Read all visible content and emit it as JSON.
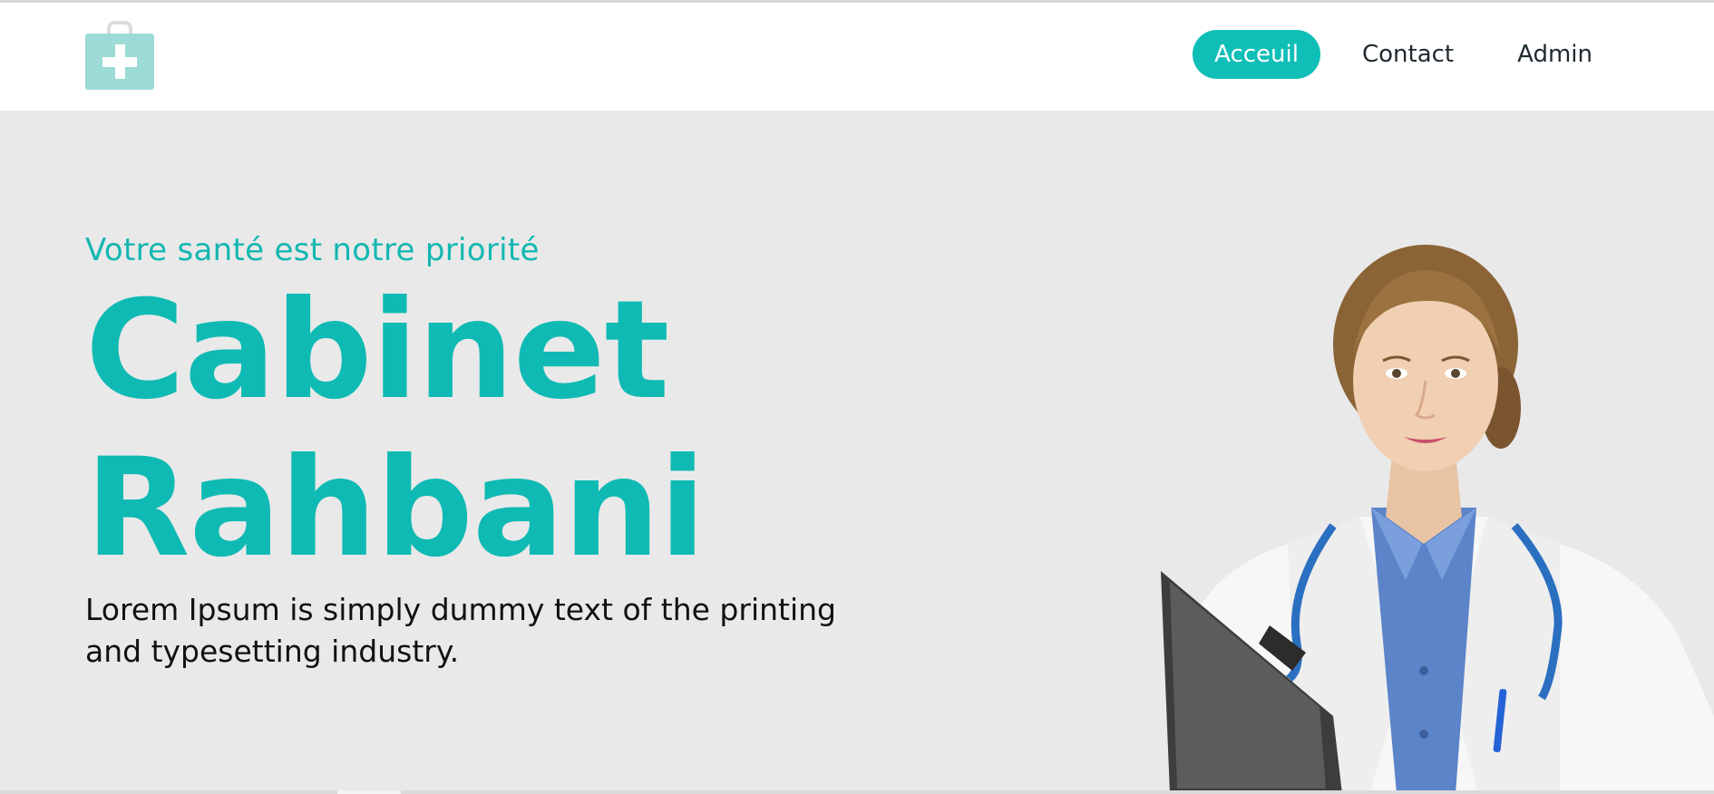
{
  "brand": {
    "logo_icon": "medical-kit-icon",
    "accent_color": "#0fbfb7"
  },
  "nav": {
    "items": [
      {
        "label": "Acceuil",
        "active": true
      },
      {
        "label": "Contact",
        "active": false
      },
      {
        "label": "Admin",
        "active": false
      }
    ]
  },
  "hero": {
    "tagline": "Votre santé est notre priorité",
    "title_line1": "Cabinet",
    "title_line2": "Rahbani",
    "description": "Lorem Ipsum is simply dummy text of the printing and typesetting industry.",
    "image": "doctor-portrait"
  }
}
